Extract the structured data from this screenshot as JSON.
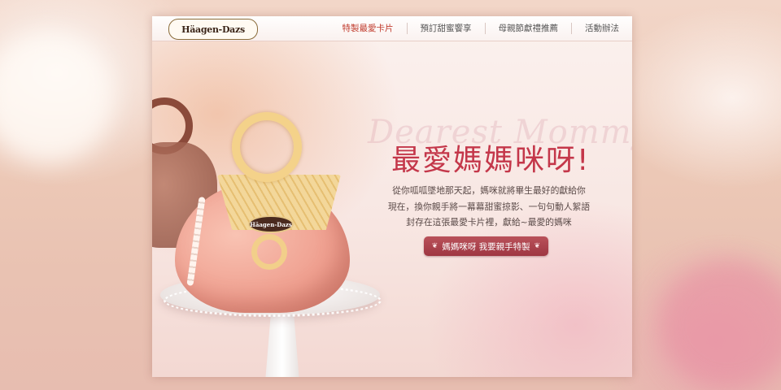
{
  "brand": {
    "logo_text": "Häagen-Dazs"
  },
  "nav": {
    "items": [
      {
        "label": "特製最愛卡片",
        "active": true
      },
      {
        "label": "預訂甜蜜饗享",
        "active": false
      },
      {
        "label": "母親節獻禮推薦",
        "active": false
      },
      {
        "label": "活動辦法",
        "active": false
      }
    ]
  },
  "hero": {
    "script_text": "Dearest Mommy",
    "headline": "最愛媽媽咪呀!",
    "copy": [
      "從你呱呱墜地那天起，媽咪就將畢生最好的獻給你",
      "現在，換你親手將一幕幕甜蜜掠影、一句句動人絮語",
      "封存在這張最愛卡片裡，獻給~最愛的媽咪"
    ],
    "cta_label": "媽媽咪呀 我要親手特製",
    "cta_left_ornament": "❦",
    "cta_right_ornament": "❦"
  },
  "product": {
    "badge_text": "Häagen-Dazs"
  },
  "colors": {
    "accent": "#c4374a",
    "cta": "#a6404b",
    "nav_active": "#c0392b"
  }
}
